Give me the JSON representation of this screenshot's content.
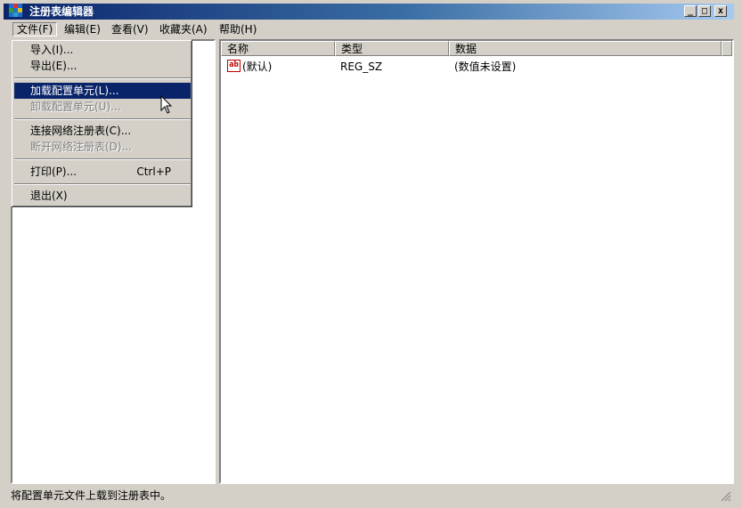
{
  "window": {
    "title": "注册表编辑器",
    "minimize": "_",
    "maximize": "□",
    "close": "x"
  },
  "menubar": {
    "file": "文件(F)",
    "edit": "编辑(E)",
    "view": "查看(V)",
    "favorites": "收藏夹(A)",
    "help": "帮助(H)"
  },
  "file_menu": {
    "import": "导入(I)...",
    "export": "导出(E)...",
    "load_hive": "加载配置单元(L)...",
    "unload_hive": "卸载配置单元(U)...",
    "connect": "连接网络注册表(C)...",
    "disconnect": "断开网络注册表(D)...",
    "print": "打印(P)...",
    "print_shortcut": "Ctrl+P",
    "exit": "退出(X)"
  },
  "list": {
    "columns": {
      "name": "名称",
      "type": "类型",
      "data": "数据"
    },
    "rows": [
      {
        "icon": "string-value-icon",
        "icon_text": "ab",
        "name": "(默认)",
        "type": "REG_SZ",
        "data": "(数值未设置)"
      }
    ]
  },
  "statusbar": {
    "text": "将配置单元文件上载到注册表中。"
  },
  "colors": {
    "titlebar": "#0a246a",
    "selection": "#0a246a",
    "face": "#d4d0c8"
  }
}
